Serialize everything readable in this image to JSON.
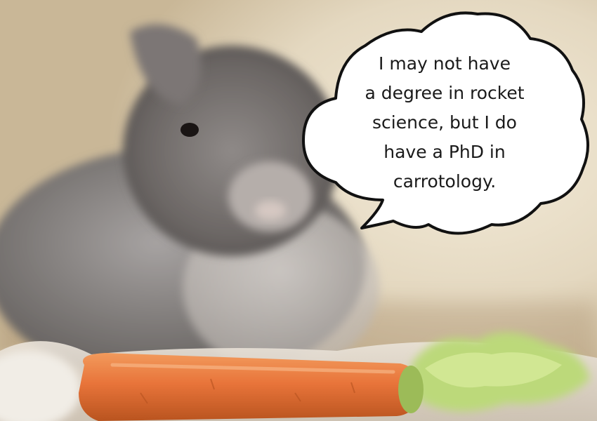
{
  "speech_bubble": {
    "lines": [
      "I may not have",
      "a degree in rocket",
      "science, but I do",
      "have a PhD in",
      "carrotology."
    ]
  },
  "colors": {
    "bubble_fill": "#ffffff",
    "bubble_stroke": "#111111",
    "carrot": "#e8743a",
    "lettuce": "#b8d86a",
    "rabbit_fur": "#8a8684"
  }
}
